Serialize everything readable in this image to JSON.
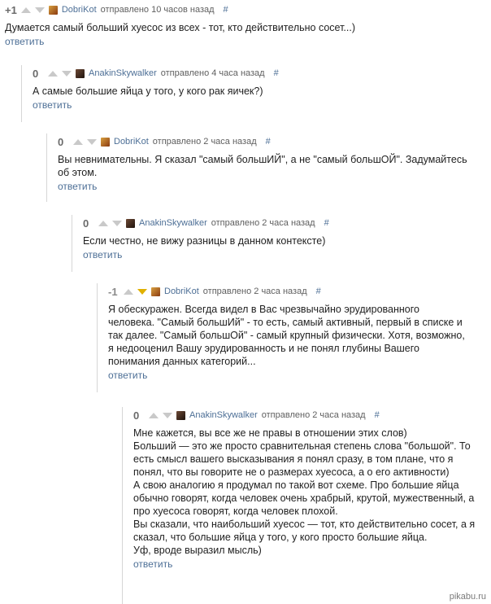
{
  "comments": [
    {
      "rating": "+1",
      "author": "DobriKot",
      "meta": "отправлено 10 часов назад",
      "hash": "#",
      "text": "Думается самый больший хуесос из всех - тот, кто действительно сосет...)",
      "reply": "ответить"
    },
    {
      "rating": "0",
      "author": "AnakinSkywalker",
      "meta": "отправлено 4 часа назад",
      "hash": "#",
      "text": "А самые большие яйца у того, у кого рак яичек?)",
      "reply": "ответить"
    },
    {
      "rating": "0",
      "author": "DobriKot",
      "meta": "отправлено 2 часа назад",
      "hash": "#",
      "text": "Вы невнимательны. Я сказал \"самый большИЙ\", а не \"самый большОЙ\". Задумайтесь об этом.",
      "reply": "ответить"
    },
    {
      "rating": "0",
      "author": "AnakinSkywalker",
      "meta": "отправлено 2 часа назад",
      "hash": "#",
      "text": "Если честно, не вижу разницы в данном контексте)",
      "reply": "ответить"
    },
    {
      "rating": "-1",
      "author": "DobriKot",
      "meta": "отправлено 2 часа назад",
      "hash": "#",
      "text": "Я обескуражен. Всегда видел в Вас чрезвычайно эрудированного человека. \"Самый большИй\" - то есть, самый активный, первый в списке и так далее. \"Самый большОй\" - самый крупный физически. Хотя, возможно, я недооценил Вашу эрудированность и не понял глубины Вашего понимания данных категорий...",
      "reply": "ответить"
    },
    {
      "rating": "0",
      "author": "AnakinSkywalker",
      "meta": "отправлено 2 часа назад",
      "hash": "#",
      "text": "Мне кажется, вы все же не правы в отношении этих слов)\nБольший — это же просто сравнительная степень слова \"большой\". То есть смысл вашего высказывания я понял сразу, в том плане, что я понял, что вы говорите не о размерах хуесоса, а о его активности)\nА свою аналогию я продумал по такой вот схеме. Про большие яйца обычно говорят, когда человек очень храбрый, крутой, мужественный, а про хуесоса говорят, когда человек плохой.\nВы сказали, что наибольший хуесос — тот, кто действительно сосет, а я сказал, что большие яйца у того, у кого просто большие яйца.\nУф, вроде выразил мысль)",
      "reply": "ответить"
    }
  ],
  "watermark": "pikabu.ru",
  "colors": {
    "link": "#4d6f96",
    "vote_inactive": "#c9c9c9",
    "vote_down_active": "#e0b000"
  }
}
